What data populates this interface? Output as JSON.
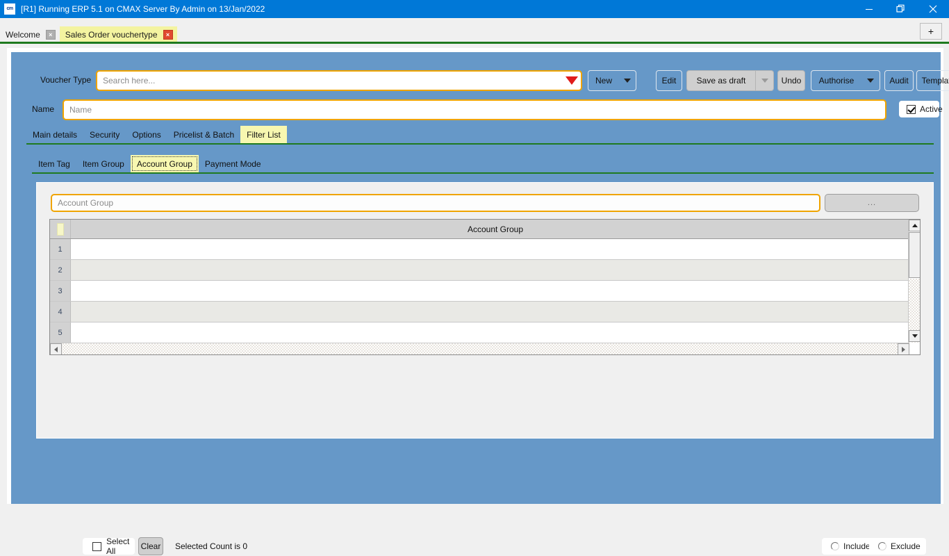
{
  "window": {
    "title": "[R1] Running ERP 5.1 on CMAX Server By Admin on 13/Jan/2022",
    "app_icon": "cm",
    "minimize": "minimize-icon",
    "restore": "restore-icon",
    "close": "close-icon"
  },
  "tabstrip": {
    "tabs": [
      {
        "label": "Welcome",
        "active": false,
        "close": "×"
      },
      {
        "label": "Sales Order vouchertype",
        "active": true,
        "close": "×"
      }
    ],
    "new_tab_label": "+"
  },
  "form": {
    "voucher_type": {
      "label": "Voucher Type",
      "value": "",
      "placeholder": "Search here...",
      "dropdown_color": "#e01b1b"
    },
    "name": {
      "label": "Name",
      "value": "",
      "placeholder": "Name"
    },
    "active": {
      "label": "Active",
      "checked": true
    },
    "toolbar": {
      "new_label": "New",
      "edit_label": "Edit",
      "save_as_draft_label": "Save as draft",
      "undo_label": "Undo",
      "authorise_label": "Authorise",
      "audit_label": "Audit",
      "template_label": "Template"
    }
  },
  "main_tabs": [
    {
      "label": "Main details",
      "selected": false
    },
    {
      "label": "Security",
      "selected": false
    },
    {
      "label": "Options",
      "selected": false
    },
    {
      "label": "Pricelist & Batch",
      "selected": false
    },
    {
      "label": "Filter List",
      "selected": true
    }
  ],
  "sub_tabs": [
    {
      "label": "Item Tag",
      "selected": false
    },
    {
      "label": "Item Group",
      "selected": false
    },
    {
      "label": "Account Group",
      "selected": true
    },
    {
      "label": "Payment Mode",
      "selected": false
    }
  ],
  "filter_panel": {
    "search": {
      "value": "",
      "placeholder": "Account Group"
    },
    "ellipsis_button_label": "...",
    "grid": {
      "column_header": "Account Group",
      "rows": [
        {
          "num": "1",
          "value": ""
        },
        {
          "num": "2",
          "value": ""
        },
        {
          "num": "3",
          "value": ""
        },
        {
          "num": "4",
          "value": ""
        },
        {
          "num": "5",
          "value": ""
        }
      ]
    },
    "footer": {
      "select_all_label": "Select All",
      "select_all_checked": false,
      "clear_label": "Clear",
      "selected_count_text": "Selected Count is 0",
      "include_label": "Include",
      "include_selected": false,
      "exclude_label": "Exclude",
      "exclude_selected": false
    }
  }
}
